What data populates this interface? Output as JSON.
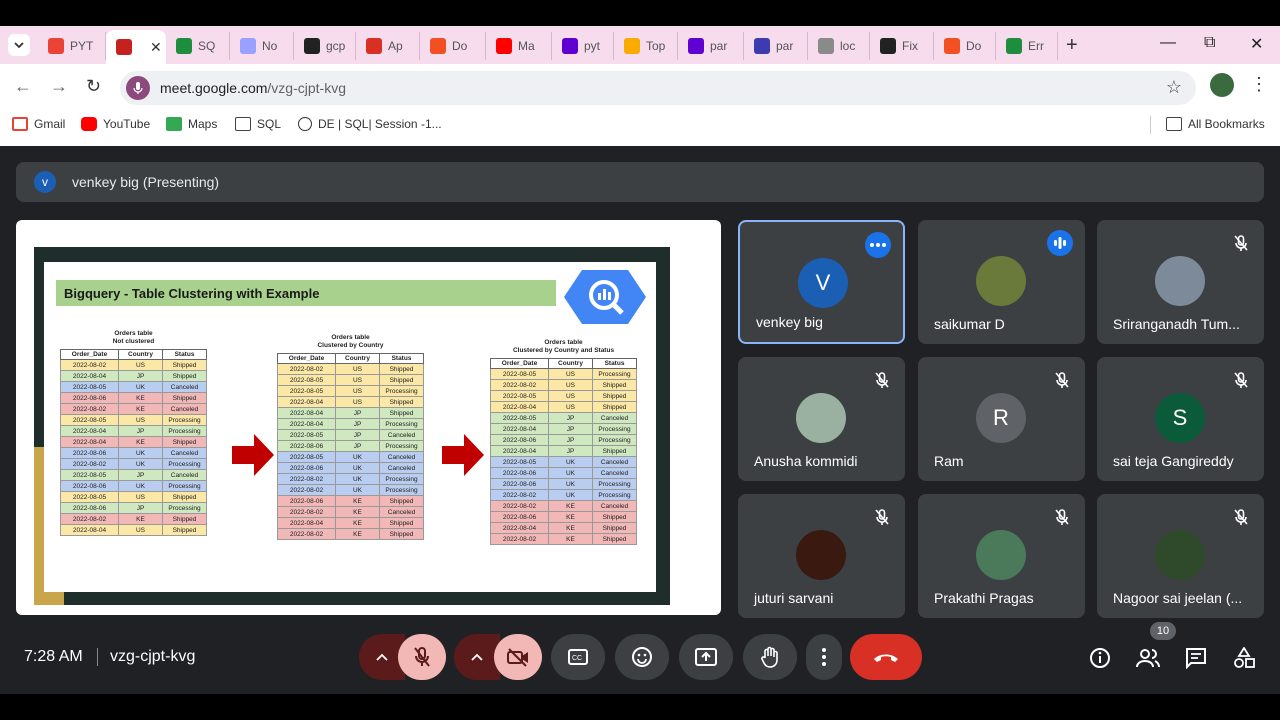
{
  "browser": {
    "tabs": [
      {
        "label": "PYT",
        "icon": "gmail-icon",
        "color": "#ea4335"
      },
      {
        "label": "",
        "icon": "record-icon",
        "color": "#c5221f",
        "active": true
      },
      {
        "label": "SQ",
        "icon": "w-icon",
        "color": "#1e8e3e"
      },
      {
        "label": "No",
        "icon": "notion-icon",
        "color": "#9aa0ff"
      },
      {
        "label": "gcp",
        "icon": "github-icon",
        "color": "#222"
      },
      {
        "label": "Ap",
        "icon": "pen-icon",
        "color": "#d93025"
      },
      {
        "label": "Do",
        "icon": "microsoft-icon",
        "color": "#f25022"
      },
      {
        "label": "Ma",
        "icon": "youtube-icon",
        "color": "#ff0000"
      },
      {
        "label": "pyt",
        "icon": "yahoo-icon",
        "color": "#5f01d1"
      },
      {
        "label": "Top",
        "icon": "smile-icon",
        "color": "#f9ab00"
      },
      {
        "label": "par",
        "icon": "yahoo-icon",
        "color": "#5f01d1"
      },
      {
        "label": "par",
        "icon": "brand-icon",
        "color": "#3c3cb0"
      },
      {
        "label": "loc",
        "icon": "drop-icon",
        "color": "#8a8a8a"
      },
      {
        "label": "Fix",
        "icon": "openai-icon",
        "color": "#222"
      },
      {
        "label": "Do",
        "icon": "microsoft-icon",
        "color": "#f25022"
      },
      {
        "label": "Err",
        "icon": "target-icon",
        "color": "#1e8e3e"
      }
    ],
    "url_host": "meet.google.com",
    "url_path": "/vzg-cjpt-kvg",
    "bookmarks": [
      "Gmail",
      "YouTube",
      "Maps",
      "SQL",
      "DE | SQL| Session -1..."
    ],
    "all_bookmarks": "All Bookmarks"
  },
  "meet": {
    "presenter_initial": "v",
    "presenter_label": "venkey big (Presenting)",
    "slide": {
      "title": "Bigquery  -  Table Clustering with Example",
      "tables": [
        {
          "caption1": "Orders table",
          "caption2": "Not clustered",
          "headers": [
            "Order_Date",
            "Country",
            "Status"
          ],
          "rows": [
            [
              "2022-08-02",
              "US",
              "Shipped"
            ],
            [
              "2022-08-04",
              "JP",
              "Shipped"
            ],
            [
              "2022-08-05",
              "UK",
              "Canceled"
            ],
            [
              "2022-08-06",
              "KE",
              "Shipped"
            ],
            [
              "2022-08-02",
              "KE",
              "Canceled"
            ],
            [
              "2022-08-05",
              "US",
              "Processing"
            ],
            [
              "2022-08-04",
              "JP",
              "Processing"
            ],
            [
              "2022-08-04",
              "KE",
              "Shipped"
            ],
            [
              "2022-08-06",
              "UK",
              "Canceled"
            ],
            [
              "2022-08-02",
              "UK",
              "Processing"
            ],
            [
              "2022-08-05",
              "JP",
              "Canceled"
            ],
            [
              "2022-08-06",
              "UK",
              "Processing"
            ],
            [
              "2022-08-05",
              "US",
              "Shipped"
            ],
            [
              "2022-08-06",
              "JP",
              "Processing"
            ],
            [
              "2022-08-02",
              "KE",
              "Shipped"
            ],
            [
              "2022-08-04",
              "US",
              "Shipped"
            ]
          ]
        },
        {
          "caption1": "Orders table",
          "caption2": "Clustered by Country",
          "headers": [
            "Order_Date",
            "Country",
            "Status"
          ],
          "rows": [
            [
              "2022-08-02",
              "US",
              "Shipped"
            ],
            [
              "2022-08-05",
              "US",
              "Shipped"
            ],
            [
              "2022-08-05",
              "US",
              "Processing"
            ],
            [
              "2022-08-04",
              "US",
              "Shipped"
            ],
            [
              "2022-08-04",
              "JP",
              "Shipped"
            ],
            [
              "2022-08-04",
              "JP",
              "Processing"
            ],
            [
              "2022-08-05",
              "JP",
              "Canceled"
            ],
            [
              "2022-08-06",
              "JP",
              "Processing"
            ],
            [
              "2022-08-05",
              "UK",
              "Canceled"
            ],
            [
              "2022-08-06",
              "UK",
              "Canceled"
            ],
            [
              "2022-08-02",
              "UK",
              "Processing"
            ],
            [
              "2022-08-02",
              "UK",
              "Processing"
            ],
            [
              "2022-08-06",
              "KE",
              "Shipped"
            ],
            [
              "2022-08-02",
              "KE",
              "Canceled"
            ],
            [
              "2022-08-04",
              "KE",
              "Shipped"
            ],
            [
              "2022-08-02",
              "KE",
              "Shipped"
            ]
          ]
        },
        {
          "caption1": "Orders table",
          "caption2": "Clustered by Country and Status",
          "headers": [
            "Order_Date",
            "Country",
            "Status"
          ],
          "rows": [
            [
              "2022-08-05",
              "US",
              "Processing"
            ],
            [
              "2022-08-02",
              "US",
              "Shipped"
            ],
            [
              "2022-08-05",
              "US",
              "Shipped"
            ],
            [
              "2022-08-04",
              "US",
              "Shipped"
            ],
            [
              "2022-08-05",
              "JP",
              "Canceled"
            ],
            [
              "2022-08-04",
              "JP",
              "Processing"
            ],
            [
              "2022-08-06",
              "JP",
              "Processing"
            ],
            [
              "2022-08-04",
              "JP",
              "Shipped"
            ],
            [
              "2022-08-05",
              "UK",
              "Canceled"
            ],
            [
              "2022-08-06",
              "UK",
              "Canceled"
            ],
            [
              "2022-08-06",
              "UK",
              "Processing"
            ],
            [
              "2022-08-02",
              "UK",
              "Processing"
            ],
            [
              "2022-08-02",
              "KE",
              "Canceled"
            ],
            [
              "2022-08-06",
              "KE",
              "Shipped"
            ],
            [
              "2022-08-04",
              "KE",
              "Shipped"
            ],
            [
              "2022-08-02",
              "KE",
              "Shipped"
            ]
          ]
        }
      ],
      "country_colors": {
        "US": "#fbe8a6",
        "JP": "#cfe8c0",
        "UK": "#b9cdf0",
        "KE": "#f2b8b8"
      }
    },
    "participants": [
      {
        "name": "venkey big",
        "initial": "V",
        "avatar_color": "#1a5fb4",
        "self": true,
        "badge": "dots"
      },
      {
        "name": "saikumar D",
        "initial": "",
        "avatar_color": "#6a7a3a",
        "badge": "speaking"
      },
      {
        "name": "Sriranganadh Tum...",
        "initial": "",
        "avatar_color": "#7c8a9a",
        "badge": "muted"
      },
      {
        "name": "Anusha kommidi",
        "initial": "",
        "avatar_color": "#9ab0a0",
        "badge": "muted"
      },
      {
        "name": "Ram",
        "initial": "R",
        "avatar_color": "#5f6368",
        "badge": "muted"
      },
      {
        "name": "sai teja Gangireddy",
        "initial": "S",
        "avatar_color": "#0b5a3a",
        "badge": "muted"
      },
      {
        "name": "juturi sarvani",
        "initial": "",
        "avatar_color": "#3a1a10",
        "badge": "muted"
      },
      {
        "name": "Prakathi Pragas",
        "initial": "",
        "avatar_color": "#4a7a5a",
        "badge": "muted"
      },
      {
        "name": "Nagoor sai jeelan (...",
        "initial": "",
        "avatar_color": "#2f4a2a",
        "badge": "muted"
      }
    ],
    "time": "7:28 AM",
    "meeting_code": "vzg-cjpt-kvg",
    "people_count": "10"
  }
}
